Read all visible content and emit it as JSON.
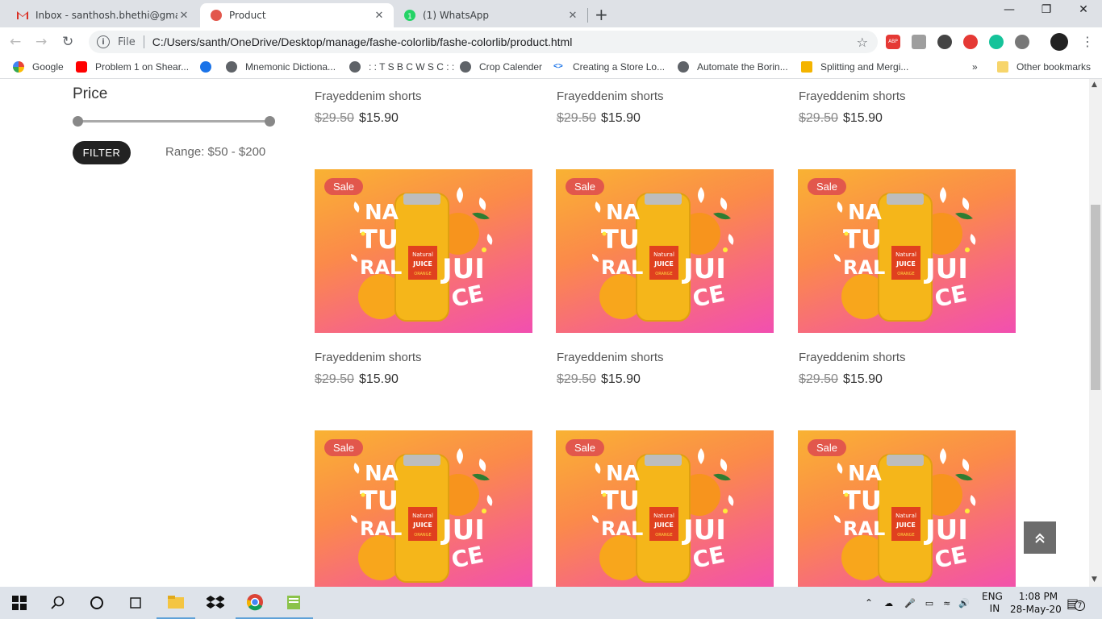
{
  "browser": {
    "tabs": [
      {
        "title": "Inbox - santhosh.bhethi@gmail.c",
        "icon": "gmail-icon",
        "active": false
      },
      {
        "title": "Product",
        "icon": "product-favicon",
        "active": true
      },
      {
        "title": "(1) WhatsApp",
        "icon": "whatsapp-icon",
        "active": false
      }
    ],
    "new_tab_label": "+",
    "close_label": "✕",
    "address": {
      "scheme": "File",
      "url": "C:/Users/santh/OneDrive/Desktop/manage/fashe-colorlib/fashe-colorlib/product.html"
    },
    "bookmarks": [
      {
        "label": "Google",
        "icon": "google-icon"
      },
      {
        "label": "Problem 1 on Shear...",
        "icon": "youtube-icon"
      },
      {
        "label": "",
        "icon": "gear-icon"
      },
      {
        "label": "Mnemonic Dictiona...",
        "icon": "globe-icon"
      },
      {
        "label": ": : T S B C W S C : :",
        "icon": "globe-icon"
      },
      {
        "label": "Crop Calender",
        "icon": "globe-icon"
      },
      {
        "label": "Creating a Store Lo...",
        "icon": "code-icon"
      },
      {
        "label": "Automate the Borin...",
        "icon": "globe-icon"
      },
      {
        "label": "Splitting and Mergi...",
        "icon": "pen-icon"
      }
    ],
    "more_bookmarks_label": "»",
    "other_bookmarks_label": "Other bookmarks"
  },
  "sidebar": {
    "price_title": "Price",
    "filter_label": "FILTER",
    "range_text": "Range: $50 - $200"
  },
  "products": {
    "sale_label": "Sale",
    "top_row": [
      {
        "name": "Frayeddenim shorts",
        "old_price": "$29.50",
        "new_price": "$15.90"
      },
      {
        "name": "Frayeddenim shorts",
        "old_price": "$29.50",
        "new_price": "$15.90"
      },
      {
        "name": "Frayeddenim shorts",
        "old_price": "$29.50",
        "new_price": "$15.90"
      }
    ],
    "middle_row": [
      {
        "name": "Frayeddenim shorts",
        "old_price": "$29.50",
        "new_price": "$15.90"
      },
      {
        "name": "Frayeddenim shorts",
        "old_price": "$29.50",
        "new_price": "$15.90"
      },
      {
        "name": "Frayeddenim shorts",
        "old_price": "$29.50",
        "new_price": "$15.90"
      }
    ],
    "image_text": {
      "na": "NA",
      "tu": "TU",
      "ral": "RAL",
      "jui": "JUI",
      "ce": "CE",
      "label_top": "Natural",
      "label_mid": "JUICE",
      "label_bot": "ORANGE"
    }
  },
  "scroll_top_icon": "double-chevron-up-icon",
  "taskbar": {
    "lang_top": "ENG",
    "lang_bottom": "IN",
    "time": "1:08 PM",
    "date": "28-May-20",
    "notification_count": "7"
  },
  "colors": {
    "sale_badge": "#e2574c",
    "filter_button": "#222222",
    "accent_orange": "#f9b233",
    "accent_pink": "#f24fb0"
  }
}
